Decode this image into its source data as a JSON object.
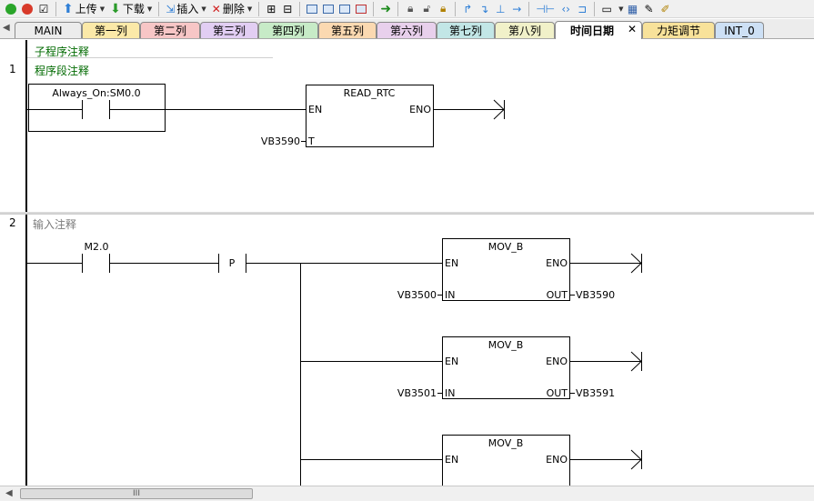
{
  "toolbar": {
    "upload_label": "上传",
    "download_label": "下载",
    "insert_label": "插入",
    "delete_label": "删除"
  },
  "tabs": [
    {
      "label": "MAIN",
      "color": "#ececec"
    },
    {
      "label": "第一列",
      "color": "#fbe9a8"
    },
    {
      "label": "第二列",
      "color": "#f7c6c6"
    },
    {
      "label": "第三列",
      "color": "#e2cef3"
    },
    {
      "label": "第四列",
      "color": "#c7ebc7"
    },
    {
      "label": "第五列",
      "color": "#fbd9b1"
    },
    {
      "label": "第六列",
      "color": "#e8d0ec"
    },
    {
      "label": "第七列",
      "color": "#c2e6e6"
    },
    {
      "label": "第八列",
      "color": "#f1f1c9"
    },
    {
      "label": "时间日期",
      "color": "#ffffff",
      "active": true
    },
    {
      "label": "力矩调节",
      "color": "#f8e29a"
    },
    {
      "label": "INT_0",
      "color": "#cde0f5"
    }
  ],
  "editor": {
    "subroutine_comment": "子程序注释",
    "networks": [
      {
        "number": "1",
        "comment": "程序段注释",
        "contact_label": "Always_On:SM0.0",
        "box": {
          "title": "READ_RTC",
          "en": "EN",
          "eno": "ENO",
          "t_pin": "T",
          "t_value": "VB3590"
        }
      },
      {
        "number": "2",
        "comment": "输入注释",
        "contact_label": "M2.0",
        "edge_label": "P",
        "boxes": [
          {
            "title": "MOV_B",
            "en": "EN",
            "eno": "ENO",
            "in_pin": "IN",
            "out_pin": "OUT",
            "in_value": "VB3500",
            "out_value": "VB3590"
          },
          {
            "title": "MOV_B",
            "en": "EN",
            "eno": "ENO",
            "in_pin": "IN",
            "out_pin": "OUT",
            "in_value": "VB3501",
            "out_value": "VB3591"
          },
          {
            "title": "MOV_B",
            "en": "EN",
            "eno": "ENO"
          }
        ]
      }
    ]
  },
  "scrollbar": {
    "thumb_grip": "III"
  }
}
